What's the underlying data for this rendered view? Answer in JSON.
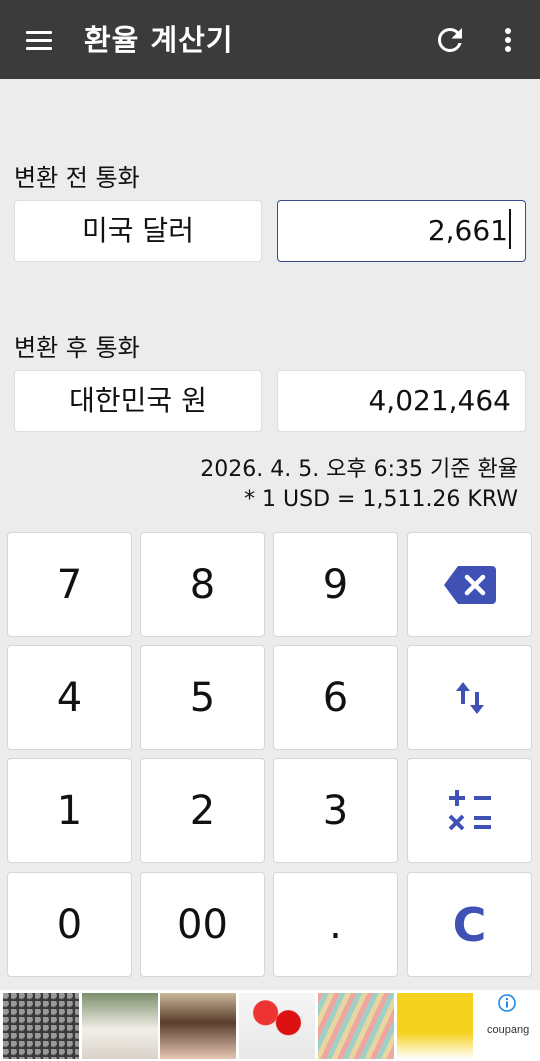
{
  "app": {
    "title": "환율 계산기"
  },
  "icons": {
    "menu": "menu-icon",
    "refresh": "refresh-icon",
    "more": "more-vert-icon"
  },
  "from": {
    "label": "변환 전 통화",
    "currency": "미국 달러",
    "amount": "2,661"
  },
  "to": {
    "label": "변환 후 통화",
    "currency": "대한민국 원",
    "amount": "4,021,464"
  },
  "rate": {
    "timestamp": "2026. 4. 5. 오후 6:35 기준 환율",
    "formula": "* 1 USD = 1,511.26 KRW"
  },
  "keypad": {
    "k7": "7",
    "k8": "8",
    "k9": "9",
    "k4": "4",
    "k5": "5",
    "k6": "6",
    "k1": "1",
    "k2": "2",
    "k3": "3",
    "k0": "0",
    "k00": "00",
    "kdot": ".",
    "clear": "C"
  },
  "colors": {
    "appbar": "#3b3b3b",
    "accent": "#3f51b5",
    "background": "#ececec"
  },
  "ad": {
    "brand": "coupang"
  }
}
